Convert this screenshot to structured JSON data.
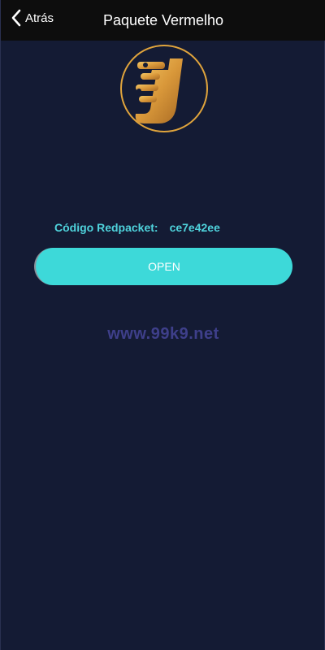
{
  "header": {
    "back_label": "Atrás",
    "title": "Paquete Vermelho"
  },
  "logo": {
    "icon": "brand-u-logo-icon"
  },
  "redpacket": {
    "code_label": "Código Redpacket:",
    "code_value": "ce7e42ee"
  },
  "actions": {
    "open_label": "OPEN"
  },
  "watermark": "www.99k9.net",
  "colors": {
    "background": "#141b34",
    "header": "#0d0d0d",
    "accent": "#3dd9d9",
    "code_text": "#4fd3dc",
    "watermark": "#3e3f8a",
    "logo_gold": "#e0a43c"
  }
}
